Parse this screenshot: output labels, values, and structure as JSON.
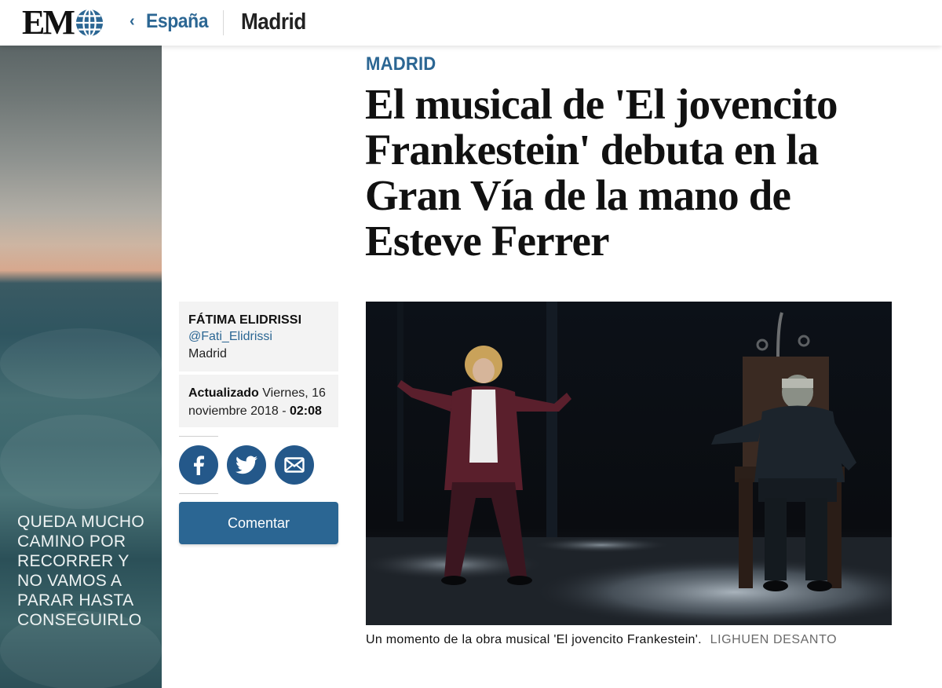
{
  "header": {
    "logo_text": "EM",
    "breadcrumb_parent": "España",
    "section": "Madrid"
  },
  "ad": {
    "text": "QUEDA MUCHO\nCAMINO POR\nRECORRER Y\nNO VAMOS A\nPARAR HASTA\nCONSEGUIRLO"
  },
  "article": {
    "kicker": "MADRID",
    "headline": "El musical de 'El jovencito Frankestein' debuta en la Gran Vía de la mano de Esteve Ferrer",
    "author": {
      "name": "FÁTIMA ELIDRISSI",
      "handle": "@Fati_Elidrissi",
      "city": "Madrid"
    },
    "updated": {
      "label": "Actualizado",
      "date": "Viernes, 16 noviembre 2018 -",
      "time": "02:08"
    },
    "comment_label": "Comentar",
    "photo": {
      "caption": "Un momento de la obra musical 'El jovencito Frankestein'.",
      "credit": "LIGHUEN DESANTO"
    }
  },
  "colors": {
    "brand_blue": "#2b6693",
    "share_blue": "#24588a"
  },
  "icons": [
    "globe-icon",
    "chevron-left-icon",
    "facebook-icon",
    "twitter-icon",
    "mail-icon"
  ]
}
